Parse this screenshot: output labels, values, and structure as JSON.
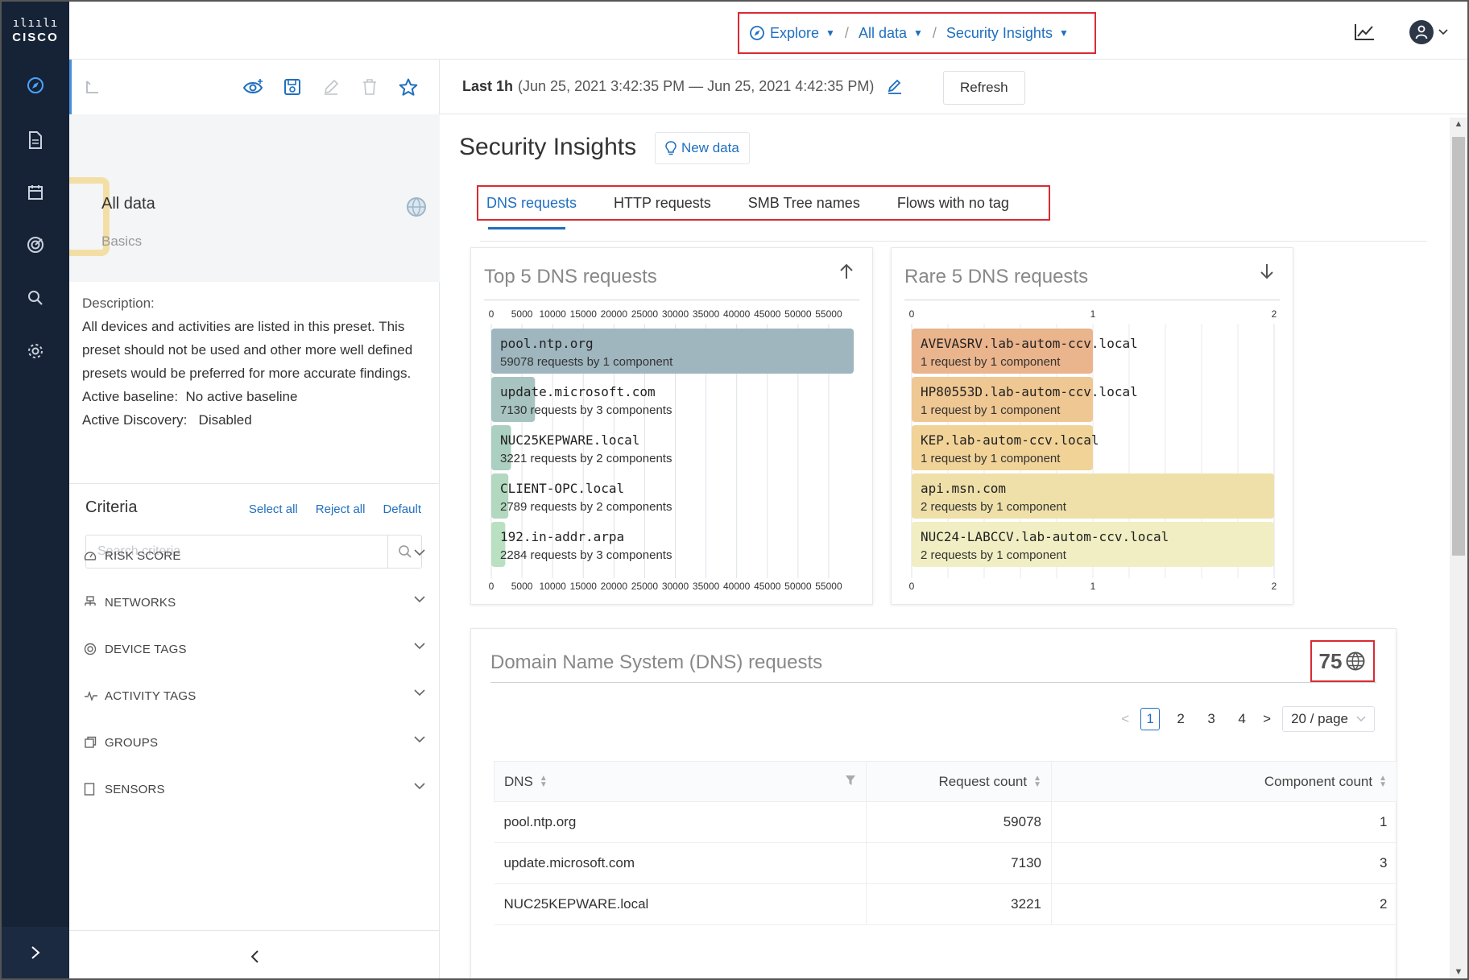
{
  "brand": {
    "name": "CISCO"
  },
  "breadcrumb": {
    "items": [
      {
        "label": "Explore"
      },
      {
        "label": "All data"
      },
      {
        "label": "Security Insights"
      }
    ],
    "separator": "/"
  },
  "preset": {
    "title": "All data",
    "subtitle": "Basics",
    "description_label": "Description:",
    "description": "All devices and activities are listed in this preset. This preset should not be used and other more well defined presets would be preferred for more accurate findings.",
    "baseline_label": "Active baseline:",
    "baseline_value": "No active baseline",
    "discovery_label": "Active Discovery:",
    "discovery_value": "Disabled"
  },
  "criteria": {
    "title": "Criteria",
    "select_all": "Select all",
    "reject_all": "Reject all",
    "default": "Default",
    "search_placeholder": "Search criteria",
    "items": [
      {
        "label": "RISK SCORE",
        "icon": "gauge-icon"
      },
      {
        "label": "NETWORKS",
        "icon": "network-icon"
      },
      {
        "label": "DEVICE TAGS",
        "icon": "tag-icon"
      },
      {
        "label": "ACTIVITY TAGS",
        "icon": "activity-icon"
      },
      {
        "label": "GROUPS",
        "icon": "group-icon"
      },
      {
        "label": "SENSORS",
        "icon": "sensor-icon"
      }
    ]
  },
  "time": {
    "range_label": "Last 1h",
    "range_detail": "(Jun 25, 2021 3:42:35 PM — Jun 25, 2021 4:42:35 PM)",
    "refresh": "Refresh"
  },
  "page": {
    "title": "Security Insights",
    "new_data": "New data",
    "tabs": [
      {
        "label": "DNS requests",
        "active": true
      },
      {
        "label": "HTTP requests",
        "active": false
      },
      {
        "label": "SMB Tree names",
        "active": false
      },
      {
        "label": "Flows with no tag",
        "active": false
      }
    ]
  },
  "colors": {
    "accent": "#1f6fbf",
    "highlight": "#d92b33",
    "nav": "#162337"
  },
  "chart_data": [
    {
      "type": "bar",
      "orientation": "horizontal",
      "title": "Top 5 DNS requests",
      "ticks": [
        0,
        5000,
        10000,
        15000,
        20000,
        25000,
        30000,
        35000,
        40000,
        45000,
        50000,
        55000
      ],
      "xlim": [
        0,
        59078
      ],
      "categories": [
        "pool.ntp.org",
        "update.microsoft.com",
        "NUC25KEPWARE.local",
        "CLIENT-OPC.local",
        "192.in-addr.arpa"
      ],
      "values": [
        59078,
        7130,
        3221,
        2789,
        2284
      ],
      "labels": [
        "59078 requests by 1 component",
        "7130 requests by 3 components",
        "3221 requests by 2 components",
        "2789 requests by 2 components",
        "2284 requests by 3 components"
      ],
      "colors": [
        "#9fb6bf",
        "#a7c4c0",
        "#abcfc0",
        "#b2d8c0",
        "#b9e0c1"
      ]
    },
    {
      "type": "bar",
      "orientation": "horizontal",
      "title": "Rare 5 DNS requests",
      "ticks": [
        0,
        1,
        2
      ],
      "xlim": [
        0,
        2
      ],
      "categories": [
        "AVEVASRV.lab-autom-ccv.local",
        "HP80553D.lab-autom-ccv.local",
        "KEP.lab-autom-ccv.local",
        "api.msn.com",
        "NUC24-LABCCV.lab-autom-ccv.local"
      ],
      "values": [
        1,
        1,
        1,
        2,
        2
      ],
      "labels": [
        "1 request by 1 component",
        "1 request by 1 component",
        "1 request by 1 component",
        "2 requests by 1 component",
        "2 requests by 1 component"
      ],
      "colors": [
        "#eab48c",
        "#efc793",
        "#f1d398",
        "#eee0a8",
        "#f0eec2"
      ]
    }
  ],
  "dns_table": {
    "title": "Domain Name System (DNS) requests",
    "count": "75",
    "pagination": {
      "pages": [
        "1",
        "2",
        "3",
        "4"
      ],
      "current": "1",
      "page_size": "20 / page"
    },
    "columns": [
      "DNS",
      "Request count",
      "Component count"
    ],
    "rows": [
      [
        "pool.ntp.org",
        "59078",
        "1"
      ],
      [
        "update.microsoft.com",
        "7130",
        "3"
      ],
      [
        "NUC25KEPWARE.local",
        "3221",
        "2"
      ]
    ]
  }
}
